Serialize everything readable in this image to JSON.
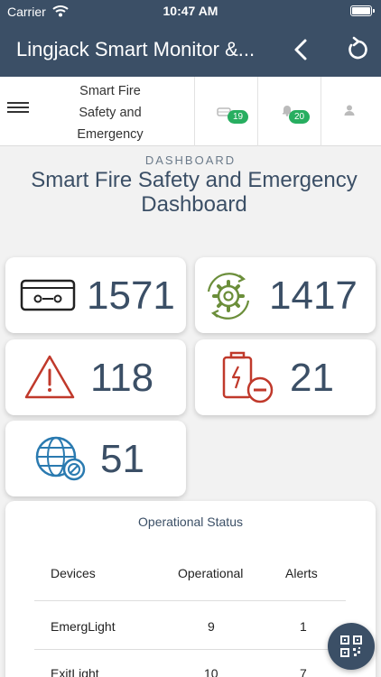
{
  "status_bar": {
    "carrier": "Carrier",
    "time": "10:47 AM"
  },
  "navbar": {
    "title": "Lingjack Smart Monitor &...",
    "icons": [
      "back-chevron-icon",
      "reload-icon"
    ]
  },
  "header": {
    "brand": "Smart Fire Safety and Emergency",
    "device_badge": "19",
    "notification_badge": "20"
  },
  "dashboard": {
    "eyebrow": "DASHBOARD",
    "title": "Smart Fire Safety and Emergency Dashboard"
  },
  "stats": [
    {
      "icon": "device-icon",
      "value": "1571"
    },
    {
      "icon": "operational-gear-icon",
      "value": "1417"
    },
    {
      "icon": "alert-triangle-icon",
      "value": "118"
    },
    {
      "icon": "low-battery-icon",
      "value": "21"
    },
    {
      "icon": "offline-network-icon",
      "value": "51"
    }
  ],
  "operational_status": {
    "title": "Operational Status",
    "columns": [
      "Devices",
      "Operational",
      "Alerts"
    ],
    "rows": [
      {
        "device": "EmergLight",
        "operational": "9",
        "alerts": "1"
      },
      {
        "device": "ExitLight",
        "operational": "10",
        "alerts": "7"
      }
    ]
  },
  "colors": {
    "primary": "#3b4f66",
    "badge": "#27ae60",
    "alert": "#c0392b",
    "ok": "#6b8e3a",
    "network": "#2a7ab0"
  }
}
